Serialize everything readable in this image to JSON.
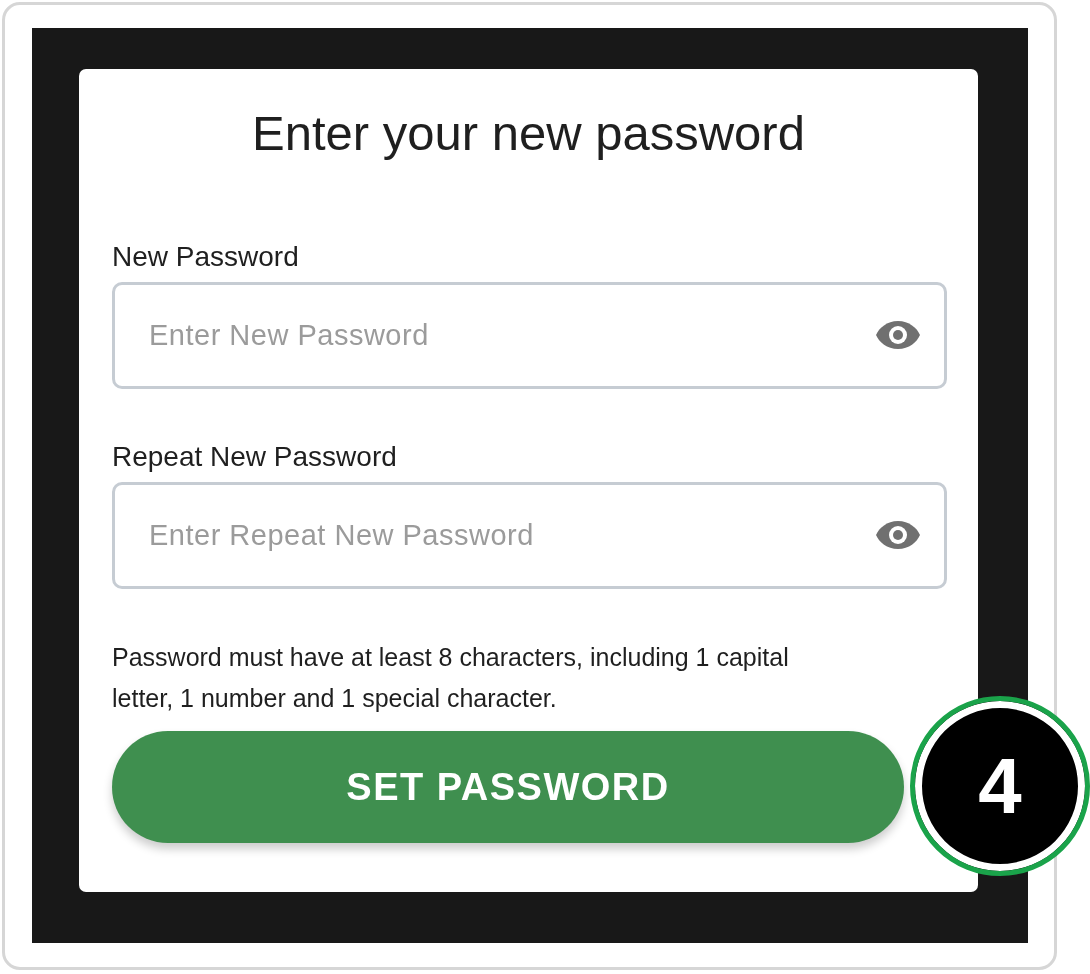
{
  "title": "Enter your new password",
  "fields": [
    {
      "label": "New Password",
      "placeholder": "Enter New Password"
    },
    {
      "label": "Repeat New Password",
      "placeholder": "Enter Repeat New Password"
    }
  ],
  "hint": "Password must have at least 8 characters, including 1 capital letter, 1 number and 1 special character.",
  "button": "SET PASSWORD",
  "step_badge": "4"
}
